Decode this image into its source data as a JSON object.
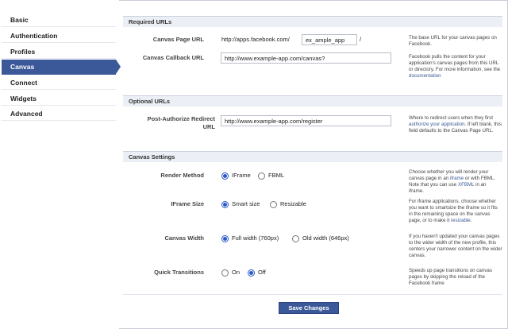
{
  "sidebar": {
    "items": [
      {
        "label": "Basic"
      },
      {
        "label": "Authentication"
      },
      {
        "label": "Profiles"
      },
      {
        "label": "Canvas"
      },
      {
        "label": "Connect"
      },
      {
        "label": "Widgets"
      },
      {
        "label": "Advanced"
      }
    ],
    "active": "Canvas"
  },
  "sections": {
    "required": {
      "title": "Required URLs",
      "canvas_page_label": "Canvas Page URL",
      "canvas_page_prefix": "http://apps.facebook.com/",
      "canvas_page_value": "ex_ample_app",
      "canvas_page_suffix": "/",
      "canvas_page_help": "The base URL for your canvas pages on Facebook.",
      "callback_label": "Canvas Callback URL",
      "callback_value": "http://www.example-app.com/canvas?",
      "callback_help": "Facebook pulls the content for your application's canvas pages from this URL or directory. For more information, see the",
      "callback_help_link": "documentation"
    },
    "optional": {
      "title": "Optional URLs",
      "redirect_label_1": "Post-Authorize Redirect",
      "redirect_label_2": "URL",
      "redirect_value": "http://www.example-app.com/register",
      "redirect_help_1": "Where to redirect users when they first",
      "redirect_help_link": "authorize your application",
      "redirect_help_2": ". If left blank, this field defaults to the Canvas Page URL."
    },
    "settings": {
      "title": "Canvas Settings",
      "render": {
        "label": "Render Method",
        "options": [
          "IFrame",
          "FBML"
        ],
        "selected": "IFrame",
        "help_1": "Choose whether you will render your canvas page in an",
        "help_link_1": "iframe",
        "help_2": "or with FBML. Note that you can use",
        "help_link_2": "XFBML",
        "help_3": "in an iframe."
      },
      "iframe_size": {
        "label": "IFrame Size",
        "options": [
          "Smart size",
          "Resizable"
        ],
        "selected": "Smart size",
        "help_1": "For iframe applications, choose whether you want to smartsize the iframe so it fits in the remaining space on the canvas page, or to make it",
        "help_link": "resizable",
        "help_2": "."
      },
      "width": {
        "label": "Canvas Width",
        "options": [
          "Full width (760px)",
          "Old width (646px)"
        ],
        "selected": "Full width (760px)",
        "help": "If you haven't updated your canvas pages to the wider width of the new profile, this centers your narrower content on the wider canvas."
      },
      "transitions": {
        "label": "Quick Transitions",
        "options": [
          "On",
          "Off"
        ],
        "selected": "Off",
        "help": "Speeds up page transitions on canvas pages by skipping the reload of the Facebook frame"
      }
    }
  },
  "save_label": "Save Changes",
  "colors": {
    "accent": "#3b5998",
    "section_bg": "#eceff5",
    "radio": "#2a58c8"
  }
}
